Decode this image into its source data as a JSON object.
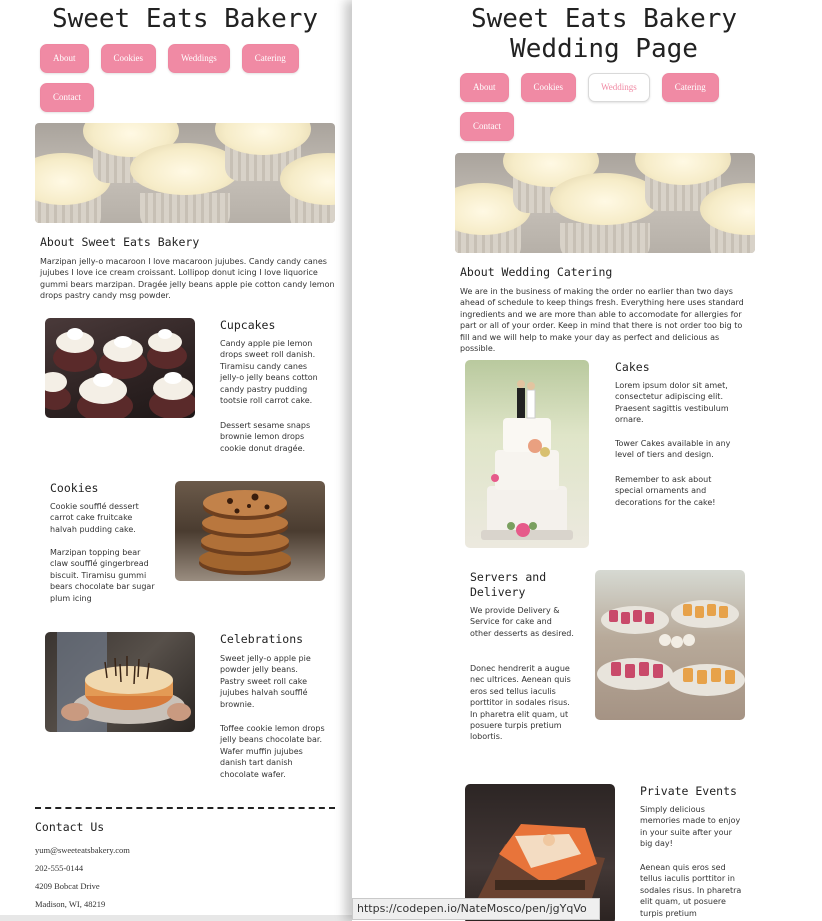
{
  "left": {
    "title": "Sweet Eats Bakery",
    "nav": [
      "About",
      "Cookies",
      "Weddings",
      "Catering",
      "Contact"
    ],
    "about_heading": "About Sweet Eats Bakery",
    "about_text": "Marzipan jelly-o macaroon I love macaroon jujubes. Candy candy canes jujubes I love ice cream croissant. Lollipop donut icing I love liquorice gummi bears marzipan. Dragée jelly beans apple pie cotton candy lemon drops pastry candy msg powder.",
    "sections": [
      {
        "heading": "Cupcakes",
        "paragraphs": [
          "Candy apple pie lemon drops sweet roll danish. Tiramisu candy canes jelly-o jelly beans cotton candy pastry pudding tootsie roll carrot cake.",
          "Dessert sesame snaps brownie lemon drops cookie donut dragée."
        ]
      },
      {
        "heading": "Cookies",
        "paragraphs": [
          "Cookie soufflé dessert carrot cake fruitcake halvah pudding cake.",
          "Marzipan topping bear claw soufflé gingerbread biscuit. Tiramisu gummi bears chocolate bar sugar plum icing"
        ]
      },
      {
        "heading": "Celebrations",
        "paragraphs": [
          "Sweet jelly-o apple pie powder jelly beans. Pastry sweet roll cake jujubes halvah soufflé brownie.",
          "Toffee cookie lemon drops jelly beans chocolate bar. Wafer muffin jujubes danish tart danish chocolate wafer."
        ]
      }
    ],
    "contact": {
      "heading": "Contact Us",
      "email": "yum@sweeteatsbakery.com",
      "phone": "202-555-0144",
      "street": "4209 Bobcat Drive",
      "city": "Madison, WI, 48219"
    }
  },
  "right": {
    "title_line1": "Sweet Eats Bakery",
    "title_line2": "Wedding Page",
    "nav": [
      "About",
      "Cookies",
      "Weddings",
      "Catering",
      "Contact"
    ],
    "active_nav": "Weddings",
    "about_heading": "About Wedding Catering",
    "about_text": "We are in the business of making the order no earlier than two days ahead of schedule to keep things fresh. Everything here uses standard ingredients and we are more than able to accomodate for allergies for part or all of your order. Keep in mind that there is not order too big to fill and we will help to make your day as perfect and delicious as possible.",
    "sections": [
      {
        "heading": "Cakes",
        "paragraphs": [
          "Lorem ipsum dolor sit amet, consectetur adipiscing elit. Praesent sagittis vestibulum ornare.",
          "Tower Cakes available in any level of tiers and design.",
          "Remember to ask about special ornaments and decorations for the cake!"
        ]
      },
      {
        "heading_line1": "Servers and",
        "heading_line2": "Delivery",
        "paragraphs": [
          "We provide Delivery & Service for cake and other desserts as desired.",
          "Donec hendrerit a augue nec ultrices. Aenean quis eros sed tellus iaculis porttitor in sodales risus. In pharetra elit quam, ut posuere turpis pretium lobortis."
        ]
      },
      {
        "heading": "Private Events",
        "paragraphs": [
          "Simply delicious memories made to enjoy in your suite after your big day!",
          "Aenean quis eros sed tellus iaculis porttitor in sodales risus. In pharetra elit quam, ut posuere turpis pretium"
        ]
      }
    ]
  },
  "status_url": "https://codepen.io/NateMosco/pen/jgYqVo",
  "colors": {
    "accent": "#f08aa4",
    "text": "#333333",
    "background": "#ffffff"
  },
  "icons": [
    "cupcakes-photo",
    "cookies-photo",
    "celebration-cake-photo",
    "wedding-cake-photo",
    "dessert-buffet-photo",
    "private-event-cake-photo"
  ]
}
